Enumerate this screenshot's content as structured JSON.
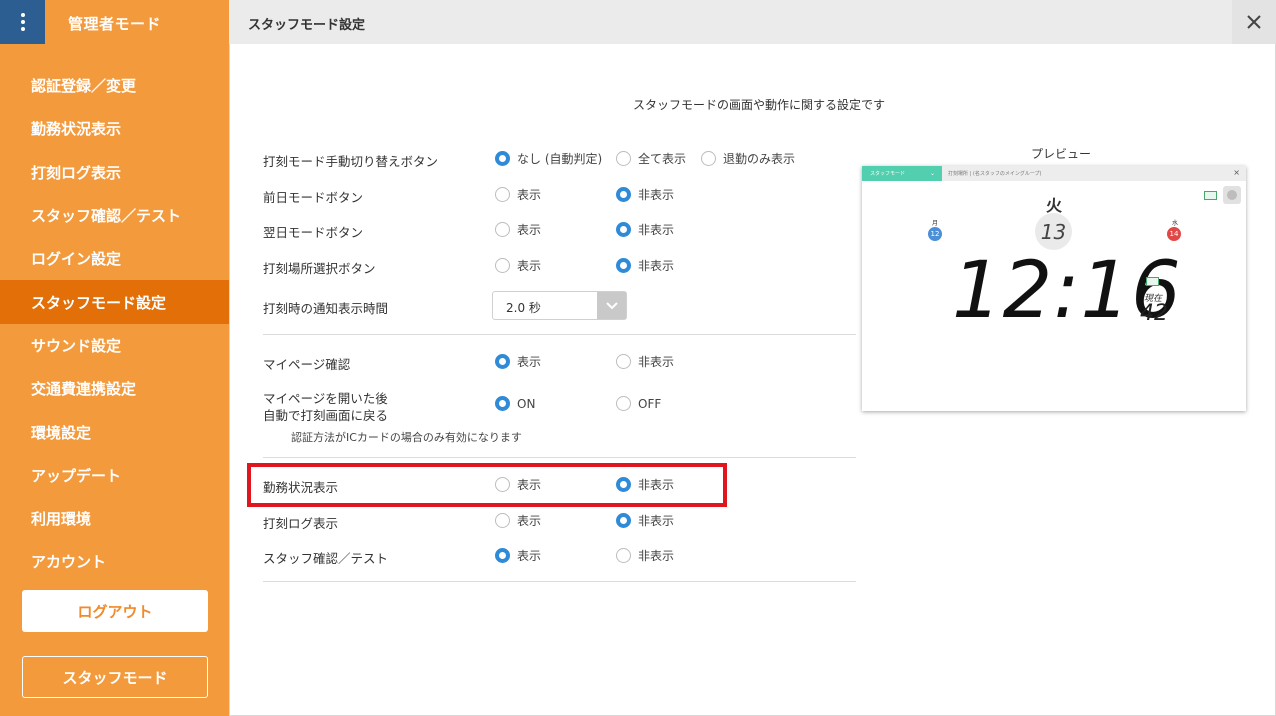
{
  "sidebar": {
    "title": "管理者モード",
    "items": [
      {
        "label": "認証登録／変更"
      },
      {
        "label": "勤務状況表示"
      },
      {
        "label": "打刻ログ表示"
      },
      {
        "label": "スタッフ確認／テスト"
      },
      {
        "label": "ログイン設定"
      },
      {
        "label": "スタッフモード設定",
        "active": true
      },
      {
        "label": "サウンド設定"
      },
      {
        "label": "交通費連携設定"
      },
      {
        "label": "環境設定"
      },
      {
        "label": "アップデート"
      },
      {
        "label": "利用環境"
      },
      {
        "label": "アカウント"
      }
    ],
    "logout_label": "ログアウト",
    "staff_mode_label": "スタッフモード"
  },
  "header": {
    "title": "スタッフモード設定"
  },
  "main": {
    "description": "スタッフモードの画面や動作に関する設定です",
    "settings": {
      "punch_mode_switch": {
        "label": "打刻モード手動切り替えボタン",
        "options": [
          "なし (自動判定)",
          "全て表示",
          "退勤のみ表示"
        ],
        "selected": 0
      },
      "prev_day": {
        "label": "前日モードボタン",
        "options": [
          "表示",
          "非表示"
        ],
        "selected": 1
      },
      "next_day": {
        "label": "翌日モードボタン",
        "options": [
          "表示",
          "非表示"
        ],
        "selected": 1
      },
      "location_select": {
        "label": "打刻場所選択ボタン",
        "options": [
          "表示",
          "非表示"
        ],
        "selected": 1
      },
      "notify_time": {
        "label": "打刻時の通知表示時間",
        "value": "2.0 秒"
      },
      "mypage_confirm": {
        "label": "マイページ確認",
        "options": [
          "表示",
          "非表示"
        ],
        "selected": 0
      },
      "mypage_return": {
        "label_line1": "マイページを開いた後",
        "label_line2": "自動で打刻画面に戻る",
        "options": [
          "ON",
          "OFF"
        ],
        "selected": 0,
        "note": "認証方法がICカードの場合のみ有効になります"
      },
      "work_status": {
        "label": "勤務状況表示",
        "options": [
          "表示",
          "非表示"
        ],
        "selected": 1
      },
      "punch_log": {
        "label": "打刻ログ表示",
        "options": [
          "表示",
          "非表示"
        ],
        "selected": 1
      },
      "staff_confirm": {
        "label": "スタッフ確認／テスト",
        "options": [
          "表示",
          "非表示"
        ],
        "selected": 0
      }
    }
  },
  "preview": {
    "label": "プレビュー",
    "tab": "スタッフモード",
    "path": "打刻場所 | (名スタッフのメイングループ)",
    "prev_day_name": "月",
    "prev_day_num": "12",
    "day_name": "火",
    "date": "13",
    "next_day_name": "水",
    "next_day_num": "14",
    "time": "12:16",
    "now_label": "現在",
    "now_count": "42",
    "colors": {
      "tab": "#52cfae",
      "prev": "#4a8fd8",
      "next": "#e04848"
    }
  }
}
